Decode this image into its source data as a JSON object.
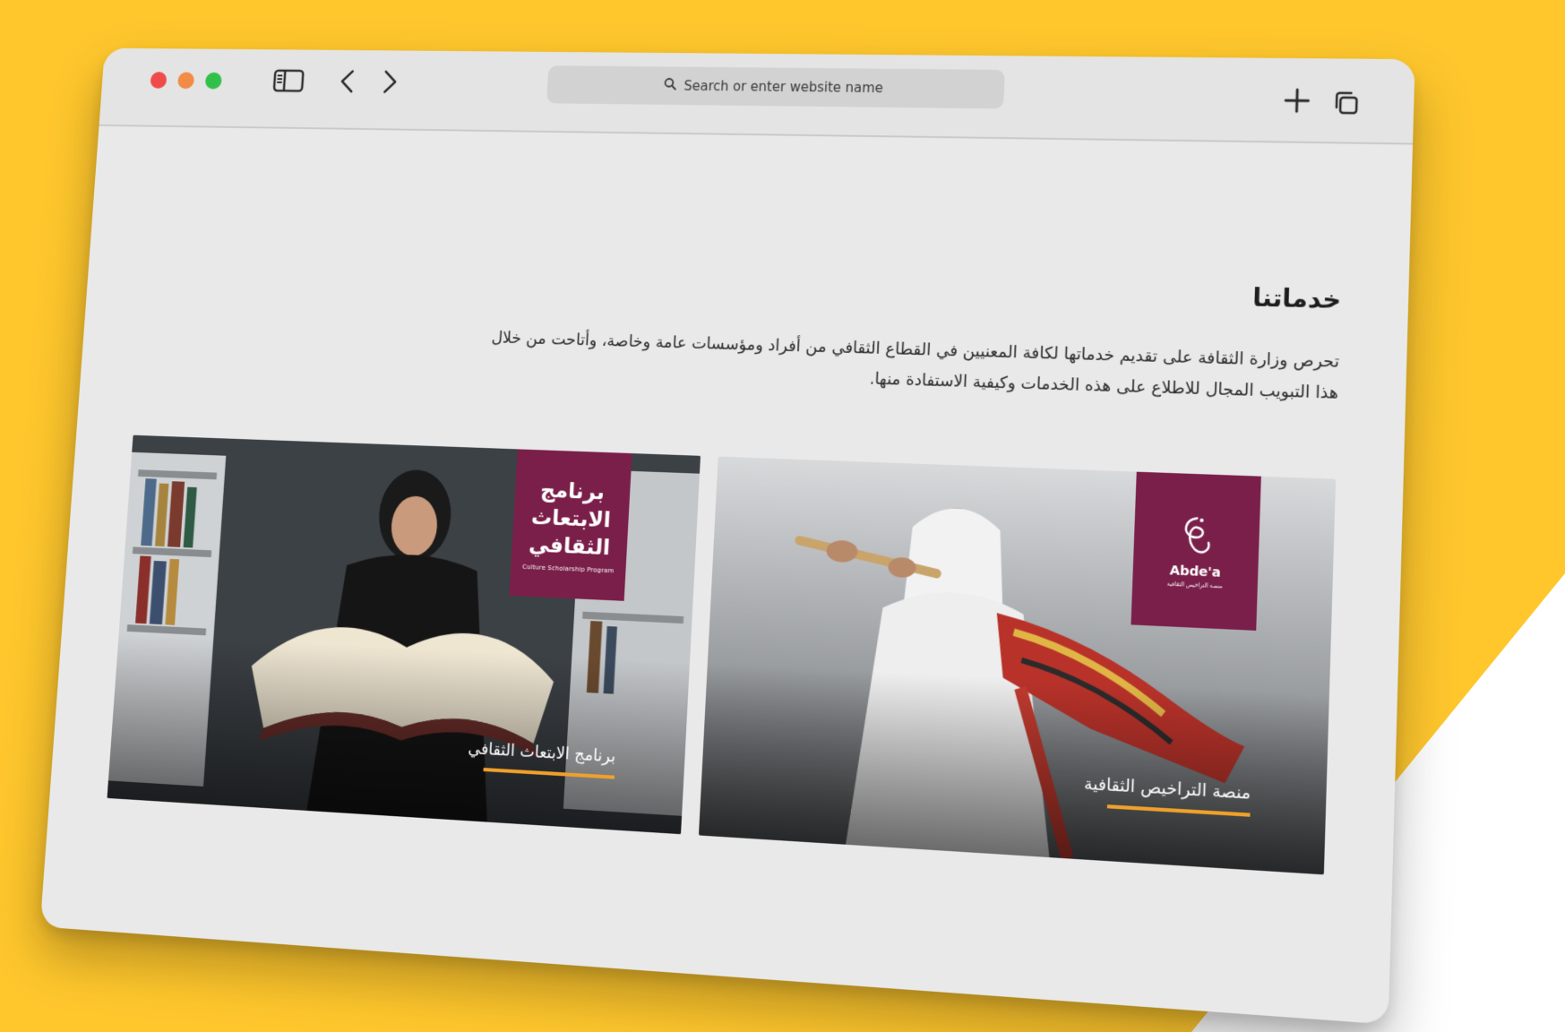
{
  "browser": {
    "address_placeholder": "Search or enter website name"
  },
  "page": {
    "section_title": "خدماتنا",
    "section_description": "تحرص وزارة الثقافة على تقديم خدماتها لكافة المعنيين في القطاع الثقافي من أفراد ومؤسسات عامة وخاصة، وأتاحت من خلال هذا التبويب المجال للاطلاع على هذه الخدمات وكيفية الاستفادة منها."
  },
  "cards": [
    {
      "label": "برنامج الابتعاث الثقافي",
      "badge_ar": "برنامج الابتعاث الثقافي",
      "badge_en": "Culture Scholarship Program"
    },
    {
      "label": "منصة التراخيص الثقافية",
      "badge_en": "Abde'a",
      "badge_sub": "منصة التراخيص الثقافية"
    }
  ],
  "colors": {
    "background": "#FFC72C",
    "badge": "#7a1f4a",
    "accent_underline": "#f0a12b"
  },
  "icons": [
    "sidebar-icon",
    "back-icon",
    "forward-icon",
    "search-icon",
    "plus-icon",
    "tabs-icon"
  ]
}
